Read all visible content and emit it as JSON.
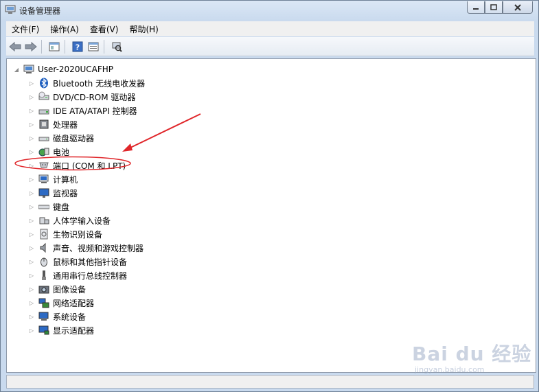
{
  "window": {
    "title": "设备管理器"
  },
  "menubar": {
    "items": [
      "文件(F)",
      "操作(A)",
      "查看(V)",
      "帮助(H)"
    ]
  },
  "tree": {
    "root": "User-2020UCAFHP",
    "nodes": [
      {
        "label": "Bluetooth 无线电收发器",
        "icon": "bluetooth-icon"
      },
      {
        "label": "DVD/CD-ROM 驱动器",
        "icon": "dvd-drive-icon"
      },
      {
        "label": "IDE ATA/ATAPI 控制器",
        "icon": "ide-controller-icon"
      },
      {
        "label": "处理器",
        "icon": "processor-icon"
      },
      {
        "label": "磁盘驱动器",
        "icon": "disk-drive-icon"
      },
      {
        "label": "电池",
        "icon": "battery-icon"
      },
      {
        "label": "端口 (COM 和 LPT)",
        "icon": "port-icon"
      },
      {
        "label": "计算机",
        "icon": "computer-icon"
      },
      {
        "label": "监视器",
        "icon": "monitor-icon"
      },
      {
        "label": "键盘",
        "icon": "keyboard-icon"
      },
      {
        "label": "人体学输入设备",
        "icon": "hid-icon"
      },
      {
        "label": "生物识别设备",
        "icon": "biometric-icon"
      },
      {
        "label": "声音、视频和游戏控制器",
        "icon": "sound-icon"
      },
      {
        "label": "鼠标和其他指针设备",
        "icon": "mouse-icon"
      },
      {
        "label": "通用串行总线控制器",
        "icon": "usb-icon"
      },
      {
        "label": "图像设备",
        "icon": "imaging-icon"
      },
      {
        "label": "网络适配器",
        "icon": "network-icon"
      },
      {
        "label": "系统设备",
        "icon": "system-icon"
      },
      {
        "label": "显示适配器",
        "icon": "display-icon"
      }
    ]
  },
  "annotation": {
    "color": "#e0262a",
    "highlighted_node": "端口 (COM 和 LPT)"
  },
  "watermark": {
    "main": "Bai du 经验",
    "sub": "jingyan.baidu.com"
  }
}
